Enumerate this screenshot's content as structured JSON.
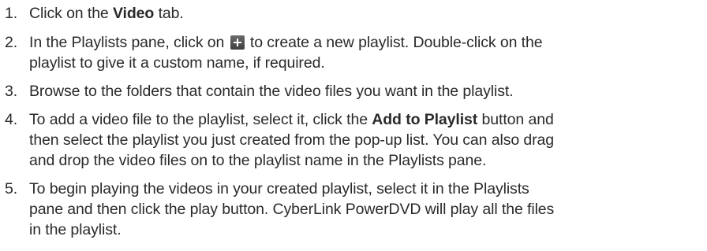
{
  "steps": [
    {
      "number": "1.",
      "before": "Click on the ",
      "bold": "Video",
      "after": " tab."
    },
    {
      "number": "2.",
      "line1_before": "In the Playlists pane, click on ",
      "icon": "plus-icon",
      "line1_after": " to create a new playlist. Double-click on the",
      "line2": "playlist to give it a custom name, if required."
    },
    {
      "number": "3.",
      "text": "Browse to the folders that contain the video files you want in the playlist."
    },
    {
      "number": "4.",
      "line1_before": "To add a video file to the playlist, select it, click the ",
      "bold": "Add to Playlist",
      "line1_after": " button and",
      "line2": "then select the playlist you just created from the pop-up list. You can also drag",
      "line3": "and drop the video files on to the playlist name in the Playlists pane."
    },
    {
      "number": "5.",
      "line1": "To begin playing the videos in your created playlist, select it in the Playlists",
      "line2": "pane and then click the play button. CyberLink PowerDVD will play all the files",
      "line3": "in the playlist."
    }
  ]
}
